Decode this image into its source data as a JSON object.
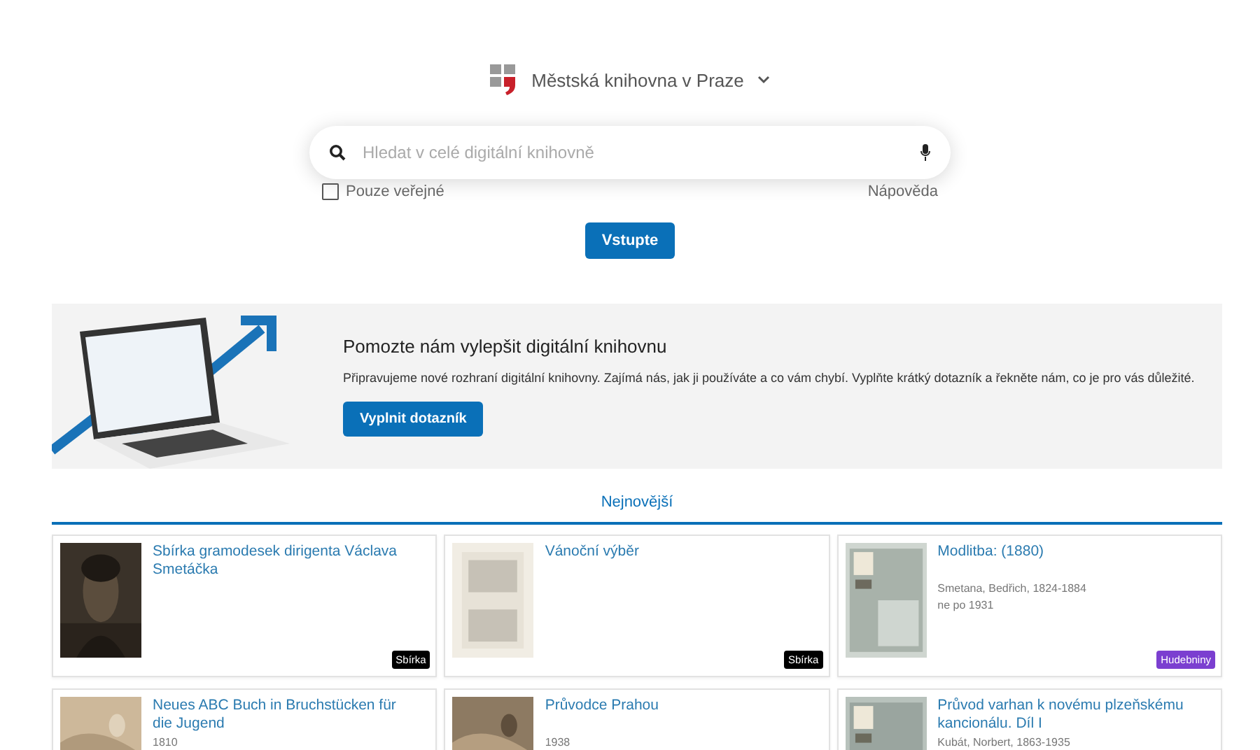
{
  "header": {
    "library": "Městská knihovna v Praze"
  },
  "search": {
    "placeholder": "Hledat v celé digitální knihovně"
  },
  "public_only": {
    "label": "Pouze veřejné",
    "checked": false
  },
  "help_link": "Nápověda",
  "enter_button": "Vstupte",
  "banner": {
    "title": "Pomozte nám vylepšit digitální knihovnu",
    "text": "Připravujeme nové rozhraní digitální knihovny. Zajímá nás, jak ji používáte a co vám chybí. Vyplňte krátký dotazník a řekněte nám, co je pro vás důležité.",
    "button": "Vyplnit dotazník"
  },
  "tabs": [
    {
      "label": "Nejnovější",
      "selected": true
    }
  ],
  "items": [
    {
      "title": "Sbírka gramodesek dirigenta Václava Smetáčka",
      "badge": {
        "label": "Sbírka",
        "color": "#000000"
      },
      "thumb": {
        "kind": "picture"
      }
    },
    {
      "title": "Vánoční výběr",
      "badge": {
        "label": "Sbírka",
        "color": "#000000"
      },
      "thumb": {
        "kind": "picture"
      }
    },
    {
      "title": "Modlitba: (1880)",
      "lines": [
        "Smetana, Bedřich, 1824-1884",
        "ne po 1931"
      ],
      "badge": {
        "label": "Hudebniny",
        "color": "#7b3fd0"
      },
      "thumb": {
        "kind": "picture"
      }
    },
    {
      "title": "Neues ABC Buch in Bruchstücken für die Jugend",
      "lines": [
        "1810"
      ],
      "thumb": {
        "kind": "picture"
      }
    },
    {
      "title": "Průvodce Prahou",
      "lines": [
        "1938"
      ],
      "thumb": {
        "kind": "picture"
      }
    },
    {
      "title": "Průvod varhan k novému plzeňskému kancionálu. Díl I",
      "lines": [
        "Kubát, Norbert, 1863-1935"
      ],
      "thumb": {
        "kind": "picture"
      }
    }
  ]
}
